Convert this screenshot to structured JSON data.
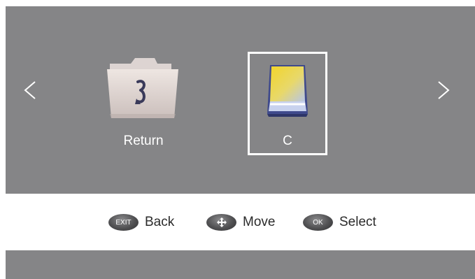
{
  "navigation": {
    "prev_icon": "chevron-left-icon",
    "next_icon": "chevron-right-icon"
  },
  "items": [
    {
      "label": "Return",
      "icon": "folder-return-icon",
      "selected": false
    },
    {
      "label": "C",
      "icon": "drive-icon",
      "selected": true
    }
  ],
  "hints": {
    "exit_key": "EXIT",
    "back": "Back",
    "move_icon": "four-way-arrows-icon",
    "move": "Move",
    "ok_key": "OK",
    "select": "Select"
  },
  "colors": {
    "panel_background": "#858587",
    "hint_background": "#ffffff",
    "selection_border": "#ffffff",
    "label_text": "#ffffff",
    "hint_text": "#2b2b2b"
  }
}
